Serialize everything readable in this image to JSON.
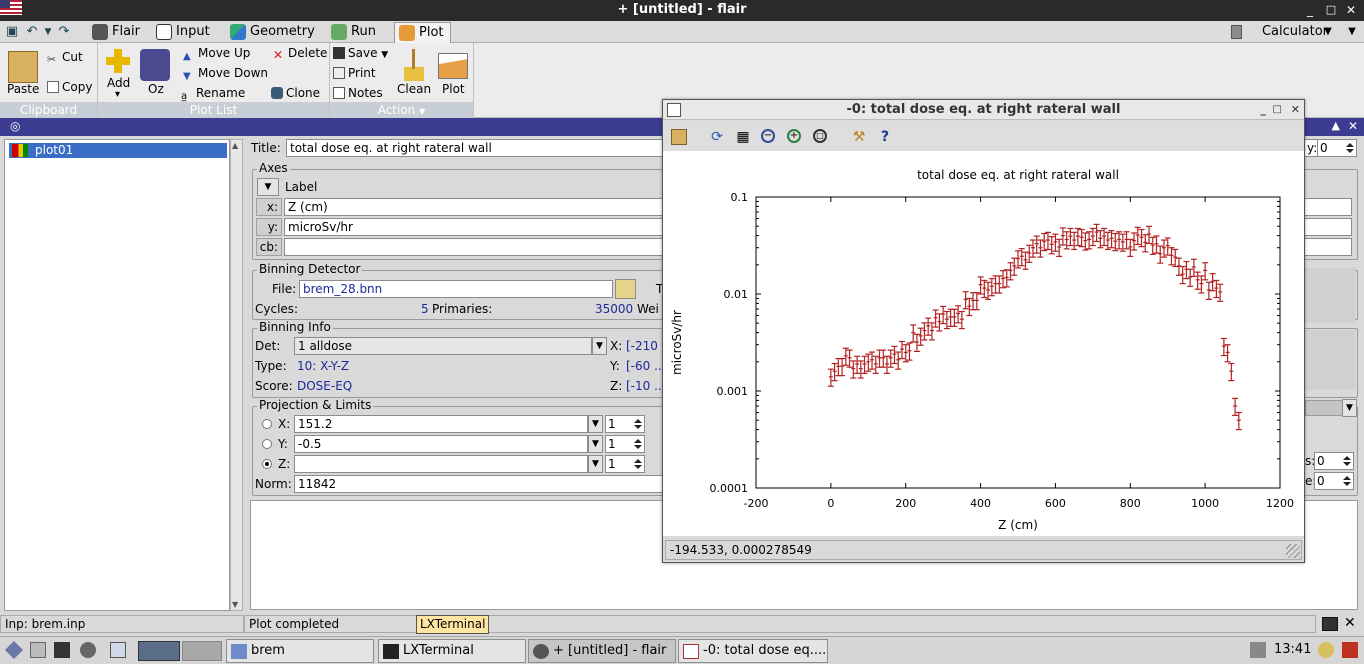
{
  "app": {
    "title": "+ [untitled] - flair"
  },
  "window_controls": {
    "minimize": "_",
    "maximize": "□",
    "close": "✕"
  },
  "tabs": [
    {
      "label": "Flair",
      "icon": "flair-cauldron-icon"
    },
    {
      "label": "Input",
      "icon": "input-icon"
    },
    {
      "label": "Geometry",
      "icon": "geometry-icon"
    },
    {
      "label": "Run",
      "icon": "run-icon"
    },
    {
      "label": "Plot",
      "icon": "plot-icon"
    }
  ],
  "calculator": {
    "label": "Calculator",
    "icon": "calculator-icon"
  },
  "ribbon": {
    "clipboard": {
      "label": "Clipboard",
      "paste": "Paste",
      "cut": "Cut",
      "copy": "Copy"
    },
    "plotlist": {
      "label": "Plot List",
      "add": "Add",
      "add_arrow": "▾",
      "oz": "Oz",
      "move_up": "Move Up",
      "move_down": "Move Down",
      "rename": "Rename",
      "delete": "Delete",
      "clone": "Clone"
    },
    "action": {
      "label": "Action",
      "save": "Save",
      "print": "Print",
      "notes": "Notes",
      "clean": "Clean",
      "plot": "Plot"
    }
  },
  "plot_list": {
    "items": [
      {
        "label": "plot01"
      }
    ]
  },
  "form": {
    "title_label": "Title:",
    "title_value": "total dose eq. at right rateral wall",
    "axes": {
      "label": "Axes",
      "col_label": "Label",
      "x_label": "x:",
      "x_value": "Z (cm)",
      "y_label": "y:",
      "y_value": "microSv/hr",
      "cb_label": "cb:",
      "cb_value": ""
    },
    "binning_detector": {
      "label": "Binning Detector",
      "file_label": "File:",
      "file_value": "brem_28.bnn",
      "t_label": "T",
      "cycles_label": "Cycles:",
      "cycles_value": "5",
      "primaries_label": "Primaries:",
      "primaries_value": "35000",
      "weight_label": "Wei"
    },
    "binning_info": {
      "label": "Binning Info",
      "det_label": "Det:",
      "det_value": "1 alldose",
      "x_label": "X:",
      "x_value": "[-210",
      "type_label": "Type:",
      "type_value": "10: X-Y-Z",
      "y_label": "Y:",
      "y_value": "[-60 ..",
      "score_label": "Score:",
      "score_value": "DOSE-EQ",
      "z_label": "Z:",
      "z_value": "[-10 .."
    },
    "projection": {
      "label": "Projection & Limits",
      "x_label": "X:",
      "x_value": "151.2",
      "x_rebin": "1",
      "y_label": "Y:",
      "y_value": "-0.5",
      "y_rebin": "1",
      "z_label": "Z:",
      "z_value": "",
      "z_rebin": "1",
      "selected": "Z",
      "norm_label": "Norm:",
      "norm_value": "11842"
    },
    "right_spin_top": {
      "label": "y:",
      "value": "0"
    },
    "right_spin_s": {
      "label": "s:",
      "value": "0"
    },
    "right_spin_e": {
      "label": "e:",
      "value": "0"
    }
  },
  "plot_window": {
    "title": "-0: total dose eq. at right rateral wall",
    "toolbar": [
      "open-icon",
      "refresh-icon",
      "grid-icon",
      "zoom-out-icon",
      "zoom-in-icon",
      "zoom-fit-icon",
      "wrench-icon",
      "help-icon"
    ],
    "status": "-194.533,  0.000278549"
  },
  "chart_data": {
    "type": "scatter",
    "title": "total dose eq. at right rateral wall",
    "xlabel": "Z (cm)",
    "ylabel": "microSv/hr",
    "xlim": [
      -200,
      1200
    ],
    "ylim": [
      0.0001,
      0.1
    ],
    "yscale": "log",
    "xticks": [
      "-200",
      "0",
      "200",
      "400",
      "600",
      "800",
      "1000",
      "1200"
    ],
    "yticks": [
      "0.0001",
      "0.001",
      "0.01",
      "0.1"
    ],
    "grid": false,
    "color": "#b22222",
    "series": [
      {
        "x": [
          0,
          10,
          20,
          30,
          40,
          50,
          60,
          70,
          80,
          90,
          100,
          110,
          120,
          130,
          140,
          150,
          160,
          170,
          180,
          190,
          200,
          210,
          220,
          230,
          240,
          250,
          260,
          270,
          280,
          290,
          300,
          310,
          320,
          330,
          340,
          350,
          360,
          370,
          380,
          390,
          400,
          410,
          420,
          430,
          440,
          450,
          460,
          470,
          480,
          490,
          500,
          510,
          520,
          530,
          540,
          550,
          560,
          570,
          580,
          590,
          600,
          610,
          620,
          630,
          640,
          650,
          660,
          670,
          680,
          690,
          700,
          710,
          720,
          730,
          740,
          750,
          760,
          770,
          780,
          790,
          800,
          810,
          820,
          830,
          840,
          850,
          860,
          870,
          880,
          890,
          900,
          910,
          920,
          930,
          940,
          950,
          960,
          970,
          980,
          990,
          1000,
          1010,
          1020,
          1030,
          1040,
          1050,
          1060,
          1070,
          1080,
          1090
        ],
        "y": [
          0.0014,
          0.0016,
          0.0018,
          0.0018,
          0.0023,
          0.0022,
          0.0017,
          0.0019,
          0.0017,
          0.0019,
          0.002,
          0.0021,
          0.0019,
          0.0022,
          0.0022,
          0.0019,
          0.0022,
          0.0024,
          0.0021,
          0.0027,
          0.0025,
          0.0026,
          0.004,
          0.0032,
          0.0037,
          0.0042,
          0.0047,
          0.0042,
          0.0057,
          0.0052,
          0.0062,
          0.0055,
          0.0058,
          0.0058,
          0.0063,
          0.0055,
          0.0088,
          0.0075,
          0.0086,
          0.0086,
          0.0125,
          0.0115,
          0.011,
          0.012,
          0.0128,
          0.0128,
          0.0145,
          0.0148,
          0.0175,
          0.0195,
          0.0232,
          0.0245,
          0.0225,
          0.0265,
          0.03,
          0.033,
          0.03,
          0.035,
          0.036,
          0.0325,
          0.0345,
          0.0305,
          0.04,
          0.0365,
          0.0395,
          0.036,
          0.0395,
          0.0385,
          0.0355,
          0.0365,
          0.0395,
          0.0435,
          0.0375,
          0.0395,
          0.036,
          0.0375,
          0.035,
          0.0365,
          0.0345,
          0.0365,
          0.0305,
          0.0355,
          0.0405,
          0.0385,
          0.034,
          0.0415,
          0.032,
          0.033,
          0.026,
          0.03,
          0.0315,
          0.025,
          0.024,
          0.0195,
          0.016,
          0.018,
          0.015,
          0.019,
          0.014,
          0.0128,
          0.0175,
          0.011,
          0.0135,
          0.0115,
          0.0105,
          0.0029,
          0.0025,
          0.0016,
          0.0007,
          0.0005
        ],
        "err_rel": 0.2
      }
    ]
  },
  "status_bar": {
    "inp": "Inp: brem.inp",
    "message": "Plot completed",
    "tooltip": "LXTerminal"
  },
  "taskbar": {
    "items": [
      {
        "label": "brem",
        "icon": "folder-icon"
      },
      {
        "label": "LXTerminal",
        "icon": "terminal-icon"
      },
      {
        "label": "+ [untitled] - flair",
        "icon": "flair-cauldron-icon"
      },
      {
        "label": "-0: total dose eq....",
        "icon": "plot-window-icon"
      }
    ],
    "clock": "13:41"
  }
}
